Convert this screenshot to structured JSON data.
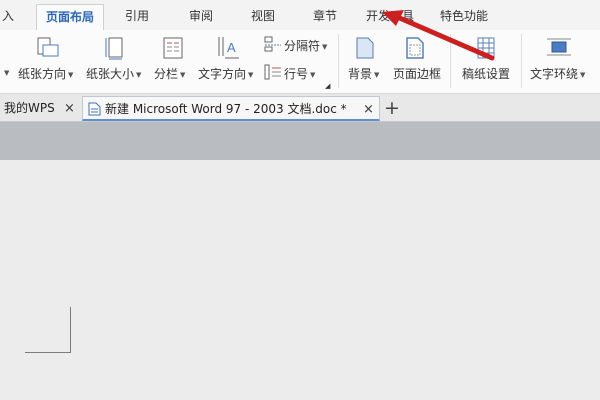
{
  "ribbon_tabs": [
    {
      "label": "插入",
      "visible_label": "入"
    },
    {
      "label": "页面布局",
      "active": true
    },
    {
      "label": "引用"
    },
    {
      "label": "审阅"
    },
    {
      "label": "视图"
    },
    {
      "label": "章节"
    },
    {
      "label": "开发工具"
    },
    {
      "label": "特色功能"
    }
  ],
  "ribbon": {
    "orientation": "纸张方向",
    "paper_size": "纸张大小",
    "columns": "分栏",
    "text_direction": "文字方向",
    "separator": "分隔符",
    "line_number": "行号",
    "background": "背景",
    "page_border": "页面边框",
    "manuscript_settings": "稿纸设置",
    "text_wrap": "文字环绕"
  },
  "doc_tabs": {
    "home": "我的WPS",
    "active_doc": "新建 Microsoft Word 97 - 2003 文档.doc *",
    "close": "×",
    "new_tab": "+"
  },
  "colors": {
    "active_tab": "#2b66b8",
    "annotation_arrow": "#cc1f1f",
    "gray_band": "#b9bcc1",
    "canvas": "#ececec"
  }
}
